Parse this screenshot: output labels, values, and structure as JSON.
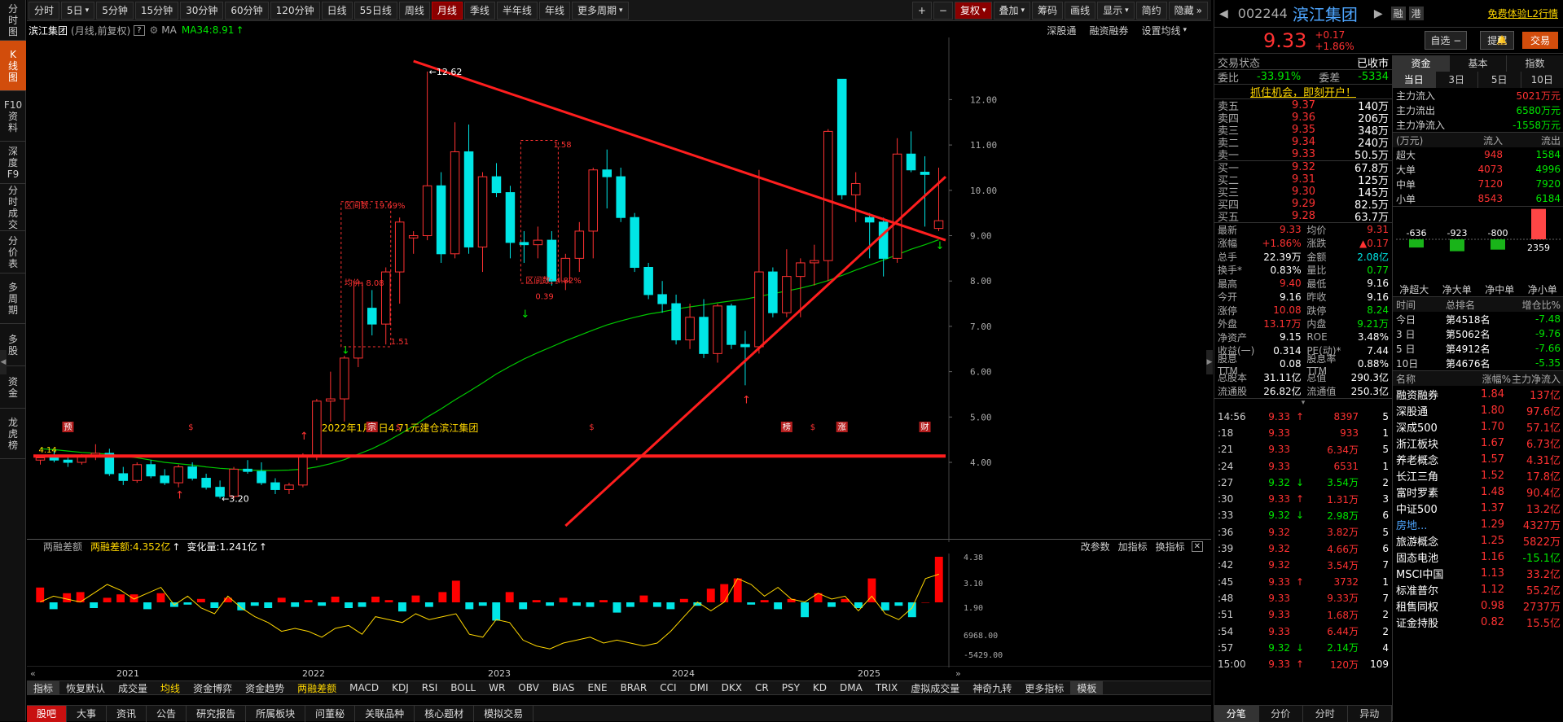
{
  "left_nav": [
    {
      "label": "分时图",
      "active": false,
      "h": 50
    },
    {
      "label": "K线图",
      "active": true,
      "h": 62
    },
    {
      "label": "F10资料",
      "active": false,
      "h": 62
    },
    {
      "label": "深度F9",
      "active": false,
      "h": 52
    },
    {
      "label": "分时成交",
      "active": false,
      "h": 58
    },
    {
      "label": "分价表",
      "active": false,
      "h": 52
    },
    {
      "label": "多周期",
      "active": false,
      "h": 62
    },
    {
      "label": "多股",
      "active": false,
      "h": 52
    },
    {
      "label": "资金",
      "active": false,
      "h": 52
    },
    {
      "label": "龙虎榜",
      "active": false,
      "h": 62
    }
  ],
  "toolbar": {
    "items": [
      "分时",
      "5日",
      "5分钟",
      "15分钟",
      "30分钟",
      "60分钟",
      "120分钟",
      "日线",
      "55日线",
      "周线",
      "月线",
      "季线",
      "半年线",
      "年线",
      "更多周期"
    ],
    "dropdowns": [
      "5日",
      "更多周期"
    ],
    "active": "月线",
    "right_items": [
      "+",
      "−",
      "复权",
      "叠加",
      "筹码",
      "画线",
      "显示",
      "简约",
      "隐藏"
    ],
    "right_active": "复权"
  },
  "chart_info": {
    "name": "滨江集团",
    "period": "(月线,前复权)",
    "help": "?",
    "ma_label": "MA",
    "ma_value": "MA34:8.91",
    "right_links": [
      "深股通",
      "融资融券",
      "设置均线"
    ]
  },
  "chart_data": {
    "type": "candlestick",
    "title": "滨江集团",
    "y_ticks": [
      12.0,
      11.0,
      10.0,
      9.0,
      8.0,
      7.0,
      6.0,
      5.0,
      4.0
    ],
    "x_labels": [
      "2021",
      "2022",
      "2023",
      "2024",
      "2025"
    ],
    "ylim": [
      2.6,
      13.3
    ],
    "candles": [
      [
        4.05,
        4.14,
        3.95,
        4.1
      ],
      [
        4.1,
        4.25,
        4.0,
        4.05
      ],
      [
        4.05,
        4.15,
        3.9,
        4.0
      ],
      [
        4.0,
        4.18,
        3.95,
        4.15
      ],
      [
        4.15,
        4.4,
        4.05,
        4.2
      ],
      [
        4.2,
        4.3,
        3.7,
        3.75
      ],
      [
        3.75,
        3.9,
        3.5,
        3.6
      ],
      [
        3.6,
        4.0,
        3.55,
        3.95
      ],
      [
        3.95,
        4.05,
        3.65,
        3.7
      ],
      [
        3.7,
        3.85,
        3.5,
        3.55
      ],
      [
        3.55,
        3.95,
        3.45,
        3.9
      ],
      [
        3.9,
        4.0,
        3.6,
        3.65
      ],
      [
        3.65,
        3.75,
        3.4,
        3.45
      ],
      [
        3.45,
        3.6,
        3.2,
        3.25
      ],
      [
        3.25,
        3.9,
        3.2,
        3.85
      ],
      [
        3.85,
        4.05,
        3.75,
        3.8
      ],
      [
        3.8,
        4.0,
        3.5,
        3.55
      ],
      [
        3.55,
        3.65,
        3.3,
        3.4
      ],
      [
        3.4,
        3.55,
        3.3,
        3.5
      ],
      [
        3.5,
        4.2,
        3.45,
        4.15
      ],
      [
        4.15,
        5.4,
        4.05,
        5.35
      ],
      [
        5.35,
        6.0,
        4.9,
        5.4
      ],
      [
        5.4,
        6.35,
        4.9,
        6.3
      ],
      [
        6.3,
        8.0,
        6.1,
        7.95
      ],
      [
        7.4,
        7.8,
        6.8,
        7.05
      ],
      [
        7.05,
        8.3,
        6.6,
        8.2
      ],
      [
        8.2,
        9.4,
        7.5,
        9.3
      ],
      [
        8.95,
        9.1,
        8.6,
        9.0
      ],
      [
        9.0,
        12.62,
        8.9,
        10.1
      ],
      [
        10.1,
        10.4,
        8.4,
        8.6
      ],
      [
        8.6,
        11.5,
        8.5,
        10.85
      ],
      [
        10.85,
        11.45,
        8.6,
        8.75
      ],
      [
        8.75,
        10.4,
        8.2,
        10.3
      ],
      [
        10.3,
        10.6,
        9.85,
        9.95
      ],
      [
        9.95,
        10.1,
        8.5,
        8.85
      ],
      [
        8.85,
        9.1,
        8.4,
        8.8
      ],
      [
        8.8,
        9.2,
        8.5,
        8.9
      ],
      [
        8.9,
        9.1,
        7.9,
        8.0
      ],
      [
        8.0,
        8.6,
        7.8,
        8.5
      ],
      [
        8.5,
        9.3,
        8.2,
        9.1
      ],
      [
        9.1,
        10.5,
        8.5,
        10.45
      ],
      [
        10.45,
        10.9,
        9.6,
        10.3
      ],
      [
        10.3,
        10.5,
        9.3,
        9.4
      ],
      [
        9.4,
        9.5,
        8.2,
        8.3
      ],
      [
        8.3,
        8.4,
        7.6,
        7.7
      ],
      [
        7.7,
        8.0,
        7.3,
        7.5
      ],
      [
        7.5,
        7.7,
        6.6,
        6.7
      ],
      [
        6.7,
        7.5,
        6.5,
        7.2
      ],
      [
        7.2,
        7.6,
        6.3,
        6.4
      ],
      [
        6.4,
        7.5,
        6.2,
        7.45
      ],
      [
        7.45,
        7.5,
        6.5,
        6.6
      ],
      [
        6.6,
        6.9,
        5.7,
        6.55
      ],
      [
        6.55,
        10.45,
        6.4,
        8.2
      ],
      [
        8.2,
        8.3,
        7.2,
        7.3
      ],
      [
        7.3,
        8.7,
        7.2,
        8.1
      ],
      [
        8.1,
        8.5,
        7.2,
        8.4
      ],
      [
        8.4,
        8.8,
        7.9,
        8.45
      ],
      [
        8.45,
        11.35,
        8.0,
        11.3
      ],
      [
        12.45,
        12.45,
        9.8,
        9.9
      ],
      [
        9.9,
        10.4,
        9.3,
        10.15
      ],
      [
        9.4,
        9.5,
        8.5,
        9.3
      ],
      [
        9.3,
        9.4,
        8.1,
        8.5
      ],
      [
        8.5,
        11.15,
        8.4,
        10.8
      ],
      [
        10.8,
        11.3,
        10.4,
        10.45
      ],
      [
        10.4,
        10.75,
        9.2,
        10.35
      ],
      [
        9.16,
        10.5,
        9.1,
        9.33
      ]
    ],
    "ma34": [
      4.3,
      4.28,
      4.25,
      4.22,
      4.2,
      4.18,
      4.14,
      4.1,
      4.05,
      4.0,
      3.97,
      3.94,
      3.9,
      3.87,
      3.85,
      3.83,
      3.82,
      3.82,
      3.83,
      3.85,
      3.9,
      3.97,
      4.06,
      4.18,
      4.3,
      4.45,
      4.62,
      4.8,
      5.0,
      5.18,
      5.38,
      5.56,
      5.75,
      5.95,
      6.12,
      6.28,
      6.42,
      6.55,
      6.68,
      6.8,
      6.92,
      7.03,
      7.12,
      7.2,
      7.27,
      7.32,
      7.38,
      7.43,
      7.47,
      7.52,
      7.56,
      7.6,
      7.66,
      7.72,
      7.78,
      7.84,
      7.92,
      8.01,
      8.12,
      8.24,
      8.35,
      8.46,
      8.58,
      8.7,
      8.8,
      8.91
    ],
    "annotations": [
      {
        "text": "12.62",
        "x_index": 28,
        "y": 12.62
      },
      {
        "text": "3.20",
        "x_index": 13,
        "y": 3.2
      },
      {
        "text": "4.14",
        "x_index": 0,
        "y": 4.14
      },
      {
        "text": "2022年1月5日4.71元建仓滨江集团",
        "x_index": 20,
        "y": 4.75
      }
    ],
    "box_notes": [
      "区间数: 19.69%",
      "均价: 8.08",
      "1.51",
      "区间数: 4.82%",
      "1.58",
      "0.39"
    ],
    "markers": [
      "预",
      "$",
      "宗",
      "$",
      "$",
      "榜",
      "$",
      "涨",
      "财"
    ]
  },
  "sub_chart": {
    "header_left": "两融差额",
    "title": "两融差额:4.352亿",
    "change": "变化量:1.241亿",
    "right_links": [
      "改参数",
      "加指标",
      "换指标"
    ],
    "y_ticks": [
      "4.38",
      "3.10",
      "1.90",
      "6968.00",
      "-5429.00"
    ],
    "bars": [
      1.3,
      -0.6,
      0.8,
      0.9,
      -0.5,
      0.4,
      0.7,
      0.7,
      -0.6,
      0.8,
      -0.4,
      -0.2,
      0.3,
      -0.5,
      0.4,
      -0.7,
      -0.3,
      -0.5,
      0.4,
      -0.4,
      0.2,
      -0.3,
      0.5,
      -0.5,
      -0.4,
      0.5,
      0.2,
      -0.8,
      0.6,
      -0.4,
      0.9,
      1.9,
      -0.6,
      -0.3,
      -1.6,
      0.9,
      -0.6,
      0.2,
      -0.3,
      0.4,
      -0.3,
      -0.4,
      0.2,
      -0.9,
      -0.4,
      0.6,
      -0.4,
      -0.6,
      0.3,
      -0.3,
      1.2,
      1.6,
      2.1,
      -0.2,
      0.2,
      -0.6,
      0.3,
      -1.3,
      0.8,
      -0.4,
      0.3,
      -0.5,
      2.1,
      -0.7,
      -0.3,
      -1.3,
      0,
      4.0
    ],
    "line": [
      3.4,
      3.6,
      3.5,
      3.4,
      3.7,
      4.0,
      3.8,
      3.5,
      3.7,
      3.9,
      3.3,
      3.6,
      3.2,
      3.0,
      3.6,
      3.2,
      2.9,
      2.7,
      2.4,
      2.5,
      2.4,
      2.2,
      2.5,
      2.6,
      2.3,
      2.9,
      2.8,
      2.7,
      3.0,
      2.8,
      2.9,
      3.0,
      2.3,
      2.2,
      2.8,
      2.7,
      2.1,
      1.9,
      1.8,
      2.0,
      2.1,
      2.2,
      2.0,
      2.1,
      2.0,
      1.9,
      2.0,
      2.4,
      2.9,
      3.4,
      3.1,
      3.4,
      4.2,
      4.0,
      3.6,
      3.9,
      3.5,
      3.4,
      3.7,
      3.5,
      3.6,
      3.1,
      3.6,
      3.0,
      2.8,
      3.2,
      4.2,
      4.35
    ]
  },
  "indicator_tabs": [
    "指标",
    "恢复默认",
    "成交量",
    "均线",
    "资金博弈",
    "资金趋势",
    "两融差额",
    "MACD",
    "KDJ",
    "RSI",
    "BOLL",
    "WR",
    "OBV",
    "BIAS",
    "ENE",
    "BRAR",
    "CCI",
    "DMI",
    "DKX",
    "CR",
    "PSY",
    "KD",
    "DMA",
    "TRIX",
    "虚拟成交量",
    "神奇九转",
    "更多指标",
    "模板"
  ],
  "indicator_active": [
    "均线",
    "两融差额"
  ],
  "bottom_tabs": [
    "股吧",
    "大事",
    "资讯",
    "公告",
    "研究报告",
    "所属板块",
    "问董秘",
    "关联品种",
    "核心题材",
    "模拟交易"
  ],
  "bottom_active": "股吧",
  "right": {
    "code": "002244",
    "name": "滨江集团",
    "badges": [
      "融",
      "港"
    ],
    "promo": "免费体验L2行情",
    "price": "9.33",
    "change": "+0.17",
    "pct": "+1.86%",
    "btn_watch": "自选 −",
    "btn_alert": "提醒",
    "btn_trade": "交易",
    "trade_status_label": "交易状态",
    "trade_status": "已收市",
    "weibi_label": "委比",
    "weibi": "-33.91%",
    "weicha_label": "委差",
    "weicha": "-5334",
    "open_account": "抓住机会，即刻开户！",
    "asks": [
      [
        "卖五",
        "9.37",
        "140万"
      ],
      [
        "卖四",
        "9.36",
        "206万"
      ],
      [
        "卖三",
        "9.35",
        "348万"
      ],
      [
        "卖二",
        "9.34",
        "240万"
      ],
      [
        "卖一",
        "9.33",
        "50.5万"
      ]
    ],
    "bids": [
      [
        "买一",
        "9.32",
        "67.8万"
      ],
      [
        "买二",
        "9.31",
        "125万"
      ],
      [
        "买三",
        "9.30",
        "145万"
      ],
      [
        "买四",
        "9.29",
        "82.5万"
      ],
      [
        "买五",
        "9.28",
        "63.7万"
      ]
    ],
    "stats": [
      [
        "最新",
        "9.33",
        "r",
        "均价",
        "9.31",
        "r"
      ],
      [
        "涨幅",
        "+1.86%",
        "r",
        "涨跌",
        "▲0.17",
        "r"
      ],
      [
        "总手",
        "22.39万",
        "w",
        "金额",
        "2.08亿",
        "c"
      ],
      [
        "换手*",
        "0.83%",
        "w",
        "量比",
        "0.77",
        "g"
      ],
      [
        "最高",
        "9.40",
        "r",
        "最低",
        "9.16",
        "w"
      ],
      [
        "今开",
        "9.16",
        "w",
        "昨收",
        "9.16",
        "w"
      ],
      [
        "涨停",
        "10.08",
        "r",
        "跌停",
        "8.24",
        "g"
      ],
      [
        "外盘",
        "13.17万",
        "r",
        "内盘",
        "9.21万",
        "g"
      ],
      [
        "净资产",
        "9.15",
        "w",
        "ROE",
        "3.48%",
        "w"
      ],
      [
        "收益(一)",
        "0.314",
        "w",
        "PE(动)*",
        "7.44",
        "w"
      ],
      [
        "股息TTM",
        "0.08",
        "w",
        "股息率TTM",
        "0.88%",
        "w"
      ],
      [
        "总股本",
        "31.11亿",
        "w",
        "总值",
        "290.3亿",
        "w"
      ],
      [
        "流通股",
        "26.82亿",
        "w",
        "流通值",
        "250.3亿",
        "w"
      ]
    ],
    "ticks": [
      [
        "14:56",
        "9.33",
        "↑",
        "8397",
        "5"
      ],
      [
        ":18",
        "9.33",
        "",
        "933",
        "1"
      ],
      [
        ":21",
        "9.33",
        "",
        "6.34万",
        "5"
      ],
      [
        ":24",
        "9.33",
        "",
        "6531",
        "1"
      ],
      [
        ":27",
        "9.32",
        "↓",
        "3.54万",
        "2"
      ],
      [
        ":30",
        "9.33",
        "↑",
        "1.31万",
        "3"
      ],
      [
        ":33",
        "9.32",
        "↓",
        "2.98万",
        "6"
      ],
      [
        ":36",
        "9.32",
        "",
        "3.82万",
        "5"
      ],
      [
        ":39",
        "9.32",
        "",
        "4.66万",
        "6"
      ],
      [
        ":42",
        "9.32",
        "",
        "3.54万",
        "7"
      ],
      [
        ":45",
        "9.33",
        "↑",
        "3732",
        "1"
      ],
      [
        ":48",
        "9.33",
        "",
        "9.33万",
        "7"
      ],
      [
        ":51",
        "9.33",
        "",
        "1.68万",
        "2"
      ],
      [
        ":54",
        "9.33",
        "",
        "6.44万",
        "2"
      ],
      [
        ":57",
        "9.32",
        "↓",
        "2.14万",
        "4"
      ],
      [
        "15:00",
        "9.33",
        "↑",
        "120万",
        "109"
      ]
    ],
    "tick_tabs": [
      "分笔",
      "分价",
      "分时",
      "异动"
    ],
    "fund_tabs": [
      "资金",
      "基本",
      "指数"
    ],
    "day_tabs": [
      "当日",
      "3日",
      "5日",
      "10日"
    ],
    "main_flow": [
      [
        "主力流入",
        "5021万元",
        "r"
      ],
      [
        "主力流出",
        "6580万元",
        "g"
      ],
      [
        "主力净流入",
        "-1558万元",
        "g"
      ]
    ],
    "flow_header": [
      "(万元)",
      "流入",
      "流出"
    ],
    "flow_rows": [
      [
        "超大",
        "948",
        "1584"
      ],
      [
        "大单",
        "4073",
        "4996"
      ],
      [
        "中单",
        "7120",
        "7920"
      ],
      [
        "小单",
        "8543",
        "6184"
      ]
    ],
    "net_bars": [
      {
        "label": "-636",
        "v": -636
      },
      {
        "label": "-923",
        "v": -923
      },
      {
        "label": "-800",
        "v": -800
      },
      {
        "label": "2359",
        "v": 2359
      }
    ],
    "net_labels": [
      "净超大",
      "净大单",
      "净中单",
      "净小单"
    ],
    "rank_header": [
      "时间",
      "总排名",
      "增仓比%"
    ],
    "rank_rows": [
      [
        "今日",
        "第4518名",
        "-7.48"
      ],
      [
        "3 日",
        "第5062名",
        "-9.76"
      ],
      [
        "5 日",
        "第4912名",
        "-7.66"
      ],
      [
        "10日",
        "第4676名",
        "-5.35"
      ]
    ],
    "sector_header": [
      "名称",
      "涨幅%",
      "主力净流入"
    ],
    "sectors": [
      [
        "融资融券",
        "1.84",
        "137亿",
        "r"
      ],
      [
        "深股通",
        "1.80",
        "97.6亿",
        "r"
      ],
      [
        "深成500",
        "1.70",
        "57.1亿",
        "r"
      ],
      [
        "浙江板块",
        "1.67",
        "6.73亿",
        "r"
      ],
      [
        "养老概念",
        "1.57",
        "4.31亿",
        "r"
      ],
      [
        "长江三角",
        "1.52",
        "17.8亿",
        "r"
      ],
      [
        "富时罗素",
        "1.48",
        "90.4亿",
        "r"
      ],
      [
        "中证500",
        "1.37",
        "13.2亿",
        "r"
      ],
      [
        "房地...",
        "1.29",
        "4327万",
        "r"
      ],
      [
        "旅游概念",
        "1.25",
        "5822万",
        "r"
      ],
      [
        "固态电池",
        "1.16",
        "-15.1亿",
        "g"
      ],
      [
        "MSCI中国",
        "1.13",
        "33.2亿",
        "r"
      ],
      [
        "标准普尔",
        "1.12",
        "55.2亿",
        "r"
      ],
      [
        "租售同权",
        "0.98",
        "2737万",
        "r"
      ],
      [
        "证金持股",
        "0.82",
        "15.5亿",
        "r"
      ]
    ]
  }
}
